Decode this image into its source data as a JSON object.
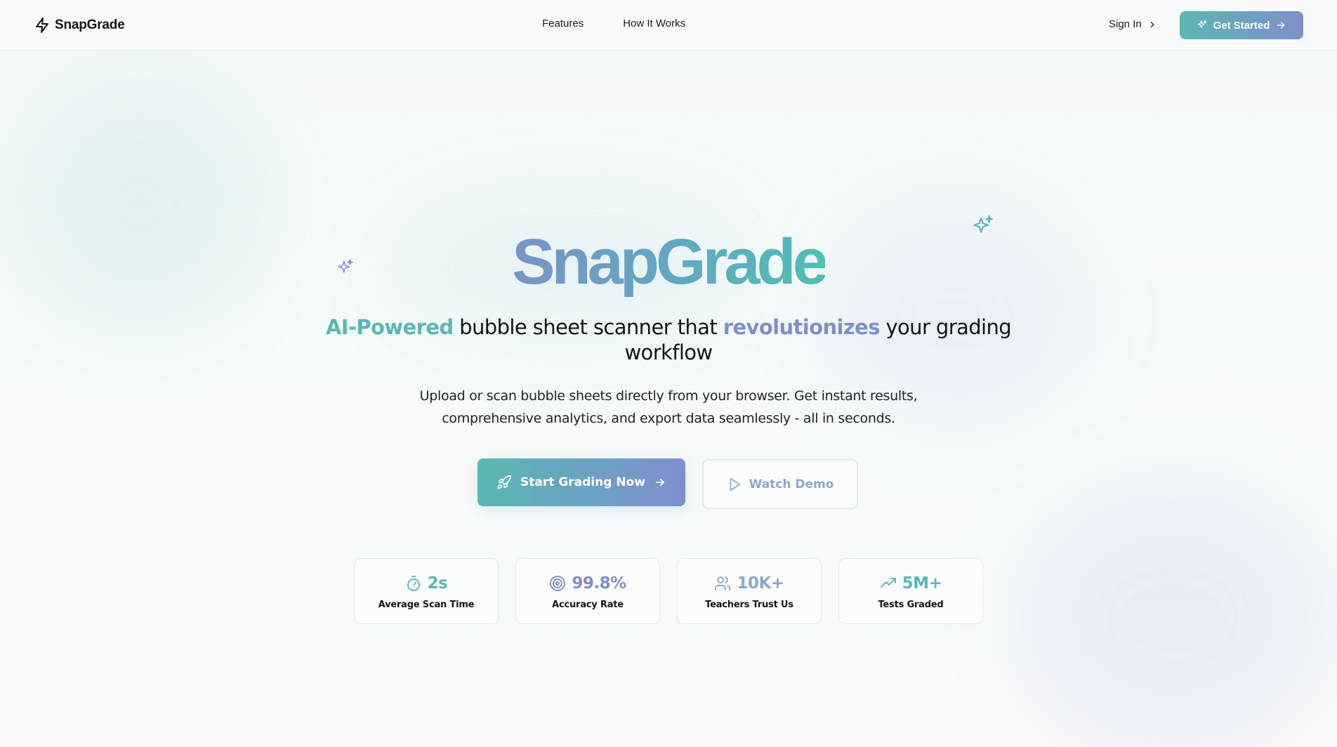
{
  "colors": {
    "teal": "#5bb7b3",
    "violet": "#7f8fcc",
    "muted_blue": "#8ea8c8"
  },
  "header": {
    "logo_icon": "lightning-bolt-icon",
    "logo_text": "SnapGrade",
    "nav": [
      {
        "label": "Features"
      },
      {
        "label": "How It Works"
      }
    ],
    "sign_in_label": "Sign In",
    "get_started_label": "Get Started"
  },
  "hero": {
    "title": "SnapGrade",
    "tagline": {
      "accent_1": "AI-Powered",
      "part_1": " bubble sheet scanner that ",
      "accent_2": "revolutionizes",
      "part_2": " your grading workflow"
    },
    "subtext_line1": "Upload or scan bubble sheets directly from your browser. Get instant results,",
    "subtext_line2": "comprehensive analytics, and export data seamlessly - all in seconds.",
    "primary_button": "Start Grading Now",
    "secondary_button": "Watch Demo"
  },
  "stats": [
    {
      "icon": "timer-icon",
      "value": "2s",
      "label": "Average Scan Time",
      "color": "#5bb7b3"
    },
    {
      "icon": "target-icon",
      "value": "99.8%",
      "label": "Accuracy Rate",
      "color": "#7f8fcc"
    },
    {
      "icon": "users-icon",
      "value": "10K+",
      "label": "Teachers Trust Us",
      "color": "#8ea8c8"
    },
    {
      "icon": "trending-up-icon",
      "value": "5M+",
      "label": "Tests Graded",
      "color": "#5bb7b3"
    }
  ]
}
